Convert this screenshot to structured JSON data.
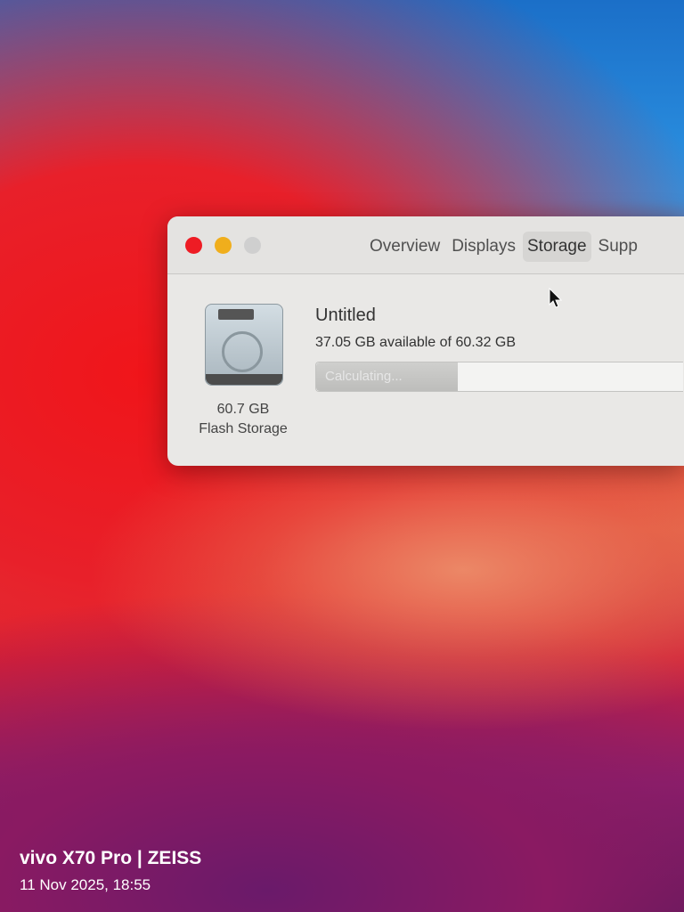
{
  "window": {
    "tabs": [
      {
        "label": "Overview"
      },
      {
        "label": "Displays"
      },
      {
        "label": "Storage",
        "active": true
      },
      {
        "label": "Supp"
      }
    ],
    "disk": {
      "capacity": "60.7 GB",
      "type": "Flash Storage"
    },
    "volume": {
      "name": "Untitled",
      "availability": "37.05 GB available of 60.32 GB",
      "status": "Calculating...",
      "used_fraction": 0.386
    }
  },
  "watermark": {
    "brand": "vivo X70 Pro | ZEISS",
    "datetime": "11 Nov 2025, 18:55"
  },
  "colors": {
    "close": "#ee1c24",
    "minimize": "#f0ae1c",
    "zoom": "#cfcfcf"
  }
}
